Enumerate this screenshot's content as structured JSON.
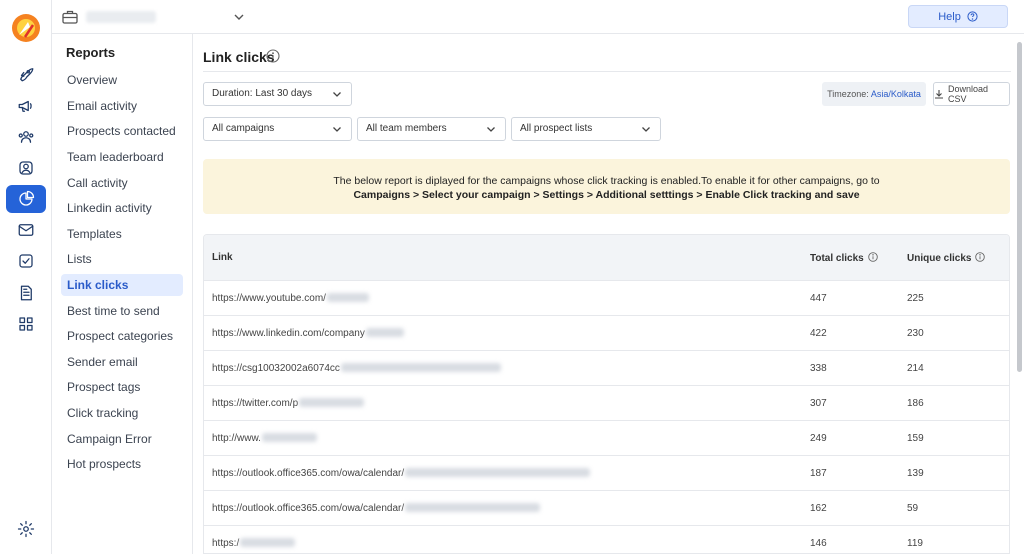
{
  "rail": {
    "items": [
      {
        "name": "rocket-icon"
      },
      {
        "name": "megaphone-icon"
      },
      {
        "name": "users-icon"
      },
      {
        "name": "user-circle-icon"
      },
      {
        "name": "pie-chart-icon",
        "active": true
      },
      {
        "name": "mail-icon"
      },
      {
        "name": "checkbox-icon"
      },
      {
        "name": "document-icon"
      },
      {
        "name": "grid-icon"
      }
    ],
    "settings_icon": "gear-icon",
    "accent": "#2563d8"
  },
  "topbar": {
    "help_label": "Help"
  },
  "subnav": {
    "title": "Reports",
    "items": [
      {
        "label": "Overview"
      },
      {
        "label": "Email activity"
      },
      {
        "label": "Prospects contacted"
      },
      {
        "label": "Team leaderboard"
      },
      {
        "label": "Call activity"
      },
      {
        "label": "Linkedin activity"
      },
      {
        "label": "Templates"
      },
      {
        "label": "Lists"
      },
      {
        "label": "Link clicks",
        "active": true
      },
      {
        "label": "Best time to send"
      },
      {
        "label": "Prospect categories"
      },
      {
        "label": "Sender email"
      },
      {
        "label": "Prospect tags"
      },
      {
        "label": "Click tracking"
      },
      {
        "label": "Campaign Error"
      },
      {
        "label": "Hot prospects"
      }
    ]
  },
  "main": {
    "title": "Link clicks",
    "duration": "Duration: Last 30 days",
    "timezone_label": "Timezone:",
    "timezone_value": "Asia/Kolkata",
    "download_label": "Download CSV",
    "filters": {
      "campaigns": "All campaigns",
      "members": "All team members",
      "lists": "All prospect lists"
    },
    "notice": {
      "line1": "The below report is diplayed for the campaigns whose click tracking is enabled.To enable it for other campaigns, go to",
      "line2": "Campaigns > Select your campaign > Settings > Additional setttings > Enable Click tracking and save"
    },
    "table": {
      "headers": {
        "link": "Link",
        "total": "Total clicks",
        "unique": "Unique clicks"
      },
      "rows": [
        {
          "link": "https://www.youtube.com/",
          "total": "447",
          "unique": "225"
        },
        {
          "link": "https://www.linkedin.com/company",
          "total": "422",
          "unique": "230"
        },
        {
          "link": "https://csg10032002a6074cc",
          "total": "338",
          "unique": "214"
        },
        {
          "link": "https://twitter.com/p",
          "total": "307",
          "unique": "186"
        },
        {
          "link": "http://www.",
          "total": "249",
          "unique": "159"
        },
        {
          "link": "https://outlook.office365.com/owa/calendar/",
          "total": "187",
          "unique": "139"
        },
        {
          "link": "https://outlook.office365.com/owa/calendar/",
          "total": "162",
          "unique": "59"
        },
        {
          "link": "https:/",
          "total": "146",
          "unique": "119"
        }
      ]
    }
  }
}
